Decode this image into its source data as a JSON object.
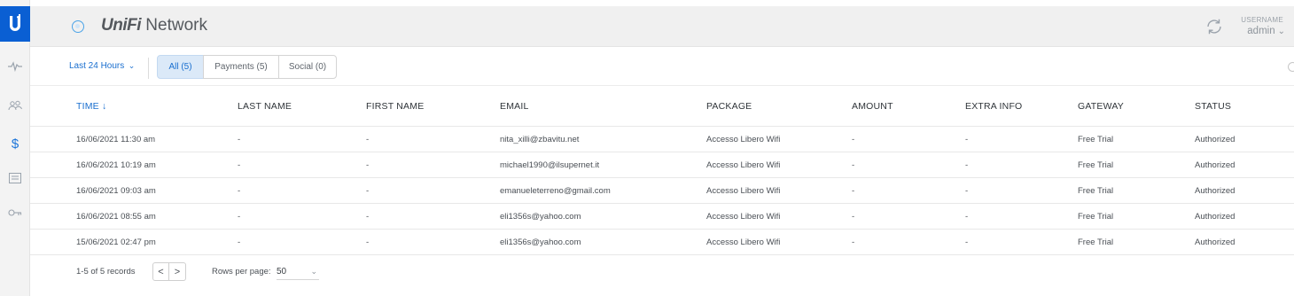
{
  "header": {
    "brand_strong": "UniFi",
    "brand_rest": " Network",
    "user_label": "USERNAME",
    "user_name": "admin"
  },
  "filters": {
    "range": "Last 24 Hours",
    "segments": [
      "All (5)",
      "Payments (5)",
      "Social (0)"
    ],
    "active_segment": "All (5)"
  },
  "table": {
    "columns": [
      "TIME ↓",
      "LAST NAME",
      "FIRST NAME",
      "EMAIL",
      "PACKAGE",
      "AMOUNT",
      "EXTRA INFO",
      "GATEWAY",
      "STATUS"
    ],
    "sorted_column": "TIME",
    "rows": [
      [
        "16/06/2021 11:30 am",
        "-",
        "-",
        "nita_xilli@zbavitu.net",
        "Accesso Libero Wifi",
        "-",
        "-",
        "Free Trial",
        "Authorized"
      ],
      [
        "16/06/2021 10:19 am",
        "-",
        "-",
        "michael1990@ilsupernet.it",
        "Accesso Libero Wifi",
        "-",
        "-",
        "Free Trial",
        "Authorized"
      ],
      [
        "16/06/2021 09:03 am",
        "-",
        "-",
        "emanueleterreno@gmail.com",
        "Accesso Libero Wifi",
        "-",
        "-",
        "Free Trial",
        "Authorized"
      ],
      [
        "16/06/2021 08:55 am",
        "-",
        "-",
        "eli1356s@yahoo.com",
        "Accesso Libero Wifi",
        "-",
        "-",
        "Free Trial",
        "Authorized"
      ],
      [
        "15/06/2021 02:47 pm",
        "-",
        "-",
        "eli1356s@yahoo.com",
        "Accesso Libero Wifi",
        "-",
        "-",
        "Free Trial",
        "Authorized"
      ]
    ]
  },
  "footer": {
    "records": "1-5 of 5 records",
    "prev_glyph": "<",
    "next_glyph": ">",
    "rows_per_page_label": "Rows per page:",
    "rows_per_page": "50"
  },
  "icons": {
    "logo": "ubiquiti-u-logo",
    "nav": [
      "statistics-icon",
      "clients-icon",
      "payments-icon",
      "vouchers-icon",
      "key-icon"
    ],
    "refresh": "refresh-icon"
  },
  "colors": {
    "accent": "#1a6fcf",
    "logo_bg": "#0a5fd3",
    "active_segment_bg": "#dbe9f8",
    "header_bg": "#f0f0f0"
  }
}
